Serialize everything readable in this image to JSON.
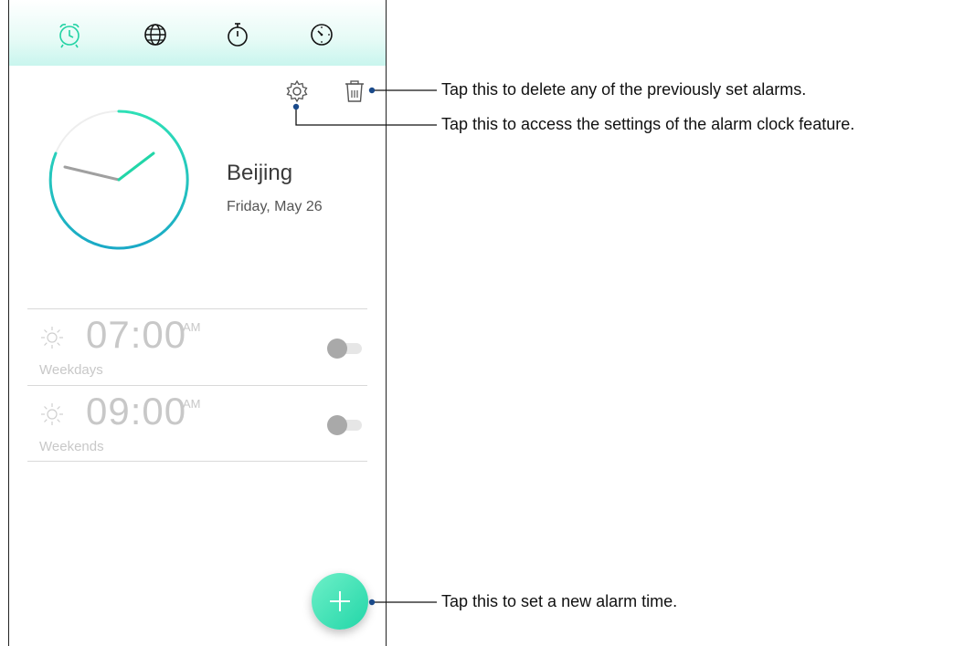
{
  "tabs": [
    {
      "name": "alarm",
      "icon": "alarm-clock-icon",
      "active": true
    },
    {
      "name": "world-clock",
      "icon": "globe-icon",
      "active": false
    },
    {
      "name": "stopwatch",
      "icon": "stopwatch-icon",
      "active": false
    },
    {
      "name": "timer",
      "icon": "timer-icon",
      "active": false
    }
  ],
  "toolbar": {
    "settings_icon": "gear-icon",
    "delete_icon": "trash-icon"
  },
  "world_clock": {
    "city": "Beijing",
    "date": "Friday, May 26"
  },
  "alarms": [
    {
      "time": "07:00",
      "ampm": "AM",
      "repeat": "Weekdays",
      "enabled": false,
      "icon": "sun-icon"
    },
    {
      "time": "09:00",
      "ampm": "AM",
      "repeat": "Weekends",
      "enabled": false,
      "icon": "sun-icon"
    }
  ],
  "fab": {
    "icon": "plus-icon"
  },
  "callouts": {
    "delete": "Tap this to delete any of the previously set alarms.",
    "settings": "Tap this to access the settings of the alarm clock feature.",
    "add": "Tap this to set a new alarm time."
  },
  "colors": {
    "accent": "#22d6a8",
    "accent_blue": "#1bb0c8",
    "hour_hand": "#a0a0a0",
    "inactive_text": "#c8c8c8"
  }
}
